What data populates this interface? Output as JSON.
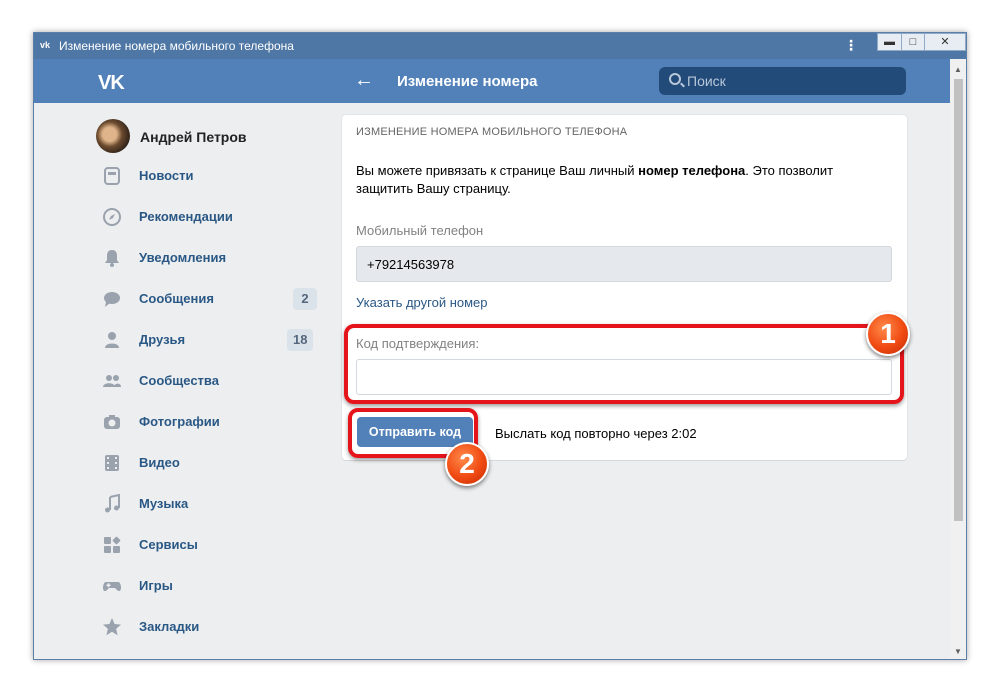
{
  "window": {
    "title": "Изменение номера мобильного телефона",
    "logo_text": "vk",
    "menu_dots": "⋮",
    "btn_min": "▬",
    "btn_max": "□",
    "btn_close": "✕"
  },
  "header": {
    "logo": "VK",
    "back": "←",
    "title": "Изменение номера",
    "search_placeholder": "Поиск"
  },
  "sidebar": {
    "profile_name": "Андрей Петров",
    "items": [
      {
        "label": "Новости",
        "icon": "news-icon"
      },
      {
        "label": "Рекомендации",
        "icon": "compass-icon"
      },
      {
        "label": "Уведомления",
        "icon": "bell-icon"
      },
      {
        "label": "Сообщения",
        "icon": "chat-icon",
        "badge": "2"
      },
      {
        "label": "Друзья",
        "icon": "user-icon",
        "badge": "18"
      },
      {
        "label": "Сообщества",
        "icon": "group-icon"
      },
      {
        "label": "Фотографии",
        "icon": "camera-icon"
      },
      {
        "label": "Видео",
        "icon": "film-icon"
      },
      {
        "label": "Музыка",
        "icon": "music-icon"
      },
      {
        "label": "Сервисы",
        "icon": "services-icon"
      },
      {
        "label": "Игры",
        "icon": "gamepad-icon"
      },
      {
        "label": "Закладки",
        "icon": "star-icon"
      }
    ]
  },
  "card": {
    "title": "ИЗМЕНЕНИЕ НОМЕРА МОБИЛЬНОГО ТЕЛЕФОНА",
    "desc_before": "Вы можете привязать к странице Ваш личный ",
    "desc_bold": "номер телефона",
    "desc_after": ". Это позволит защитить Вашу страницу.",
    "phone_label": "Мобильный телефон",
    "phone_value": "+79214563978",
    "change_link": "Указать другой номер",
    "code_label": "Код подтверждения:",
    "code_value": "",
    "send_button": "Отправить код",
    "resend_text": "Выслать код повторно через 2:02"
  },
  "annotations": {
    "marker1": "1",
    "marker2": "2",
    "color": "#e5141b"
  },
  "colors": {
    "header": "#5181b8",
    "link": "#2a5885",
    "background": "#edeef0"
  }
}
